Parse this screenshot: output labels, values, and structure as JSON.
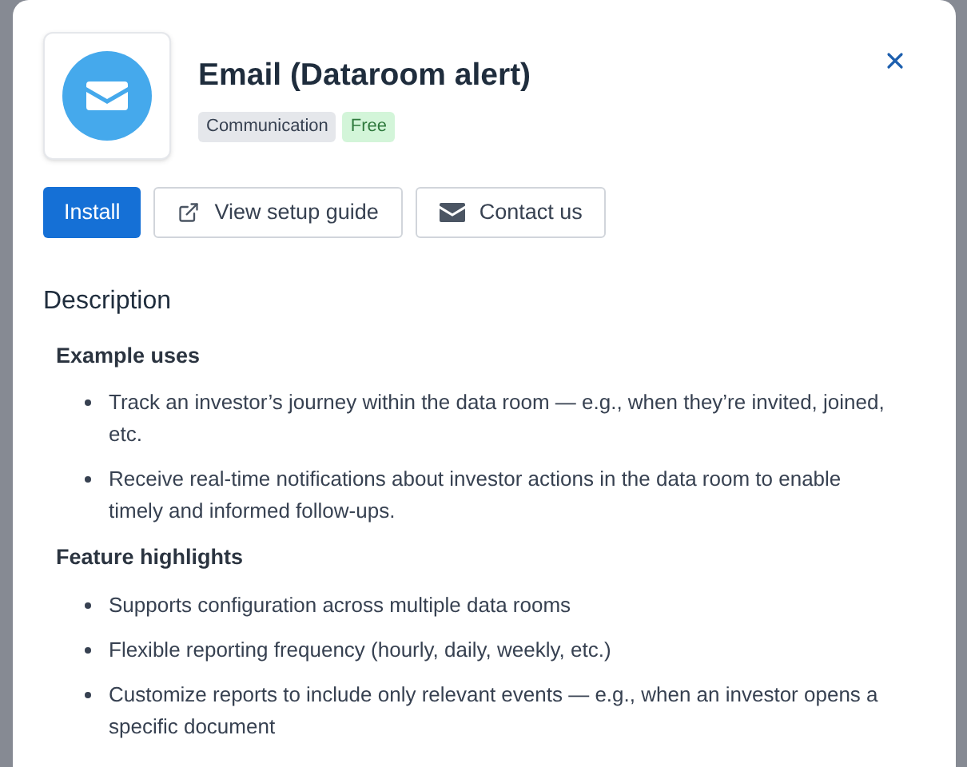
{
  "app": {
    "title": "Email (Dataroom alert)",
    "tags": [
      {
        "label": "Communication",
        "kind": "category"
      },
      {
        "label": "Free",
        "kind": "price"
      }
    ]
  },
  "actions": [
    {
      "label": "Install",
      "kind": "primary"
    },
    {
      "label": "View setup guide",
      "kind": "guide"
    },
    {
      "label": "Contact us",
      "kind": "contact"
    }
  ],
  "description": {
    "heading": "Description",
    "sections": [
      {
        "heading": "Example uses",
        "items": [
          "Track an investor’s journey within the data room — e.g., when they’re invited, joined, etc.",
          "Receive real-time notifications about investor actions in the data room to enable timely and informed follow-ups."
        ]
      },
      {
        "heading": "Feature highlights",
        "items": [
          "Supports configuration across multiple data rooms",
          "Flexible reporting frequency (hourly, daily, weekly, etc.)",
          "Customize reports to include only relevant events — e.g., when an investor opens a specific document"
        ]
      }
    ]
  }
}
